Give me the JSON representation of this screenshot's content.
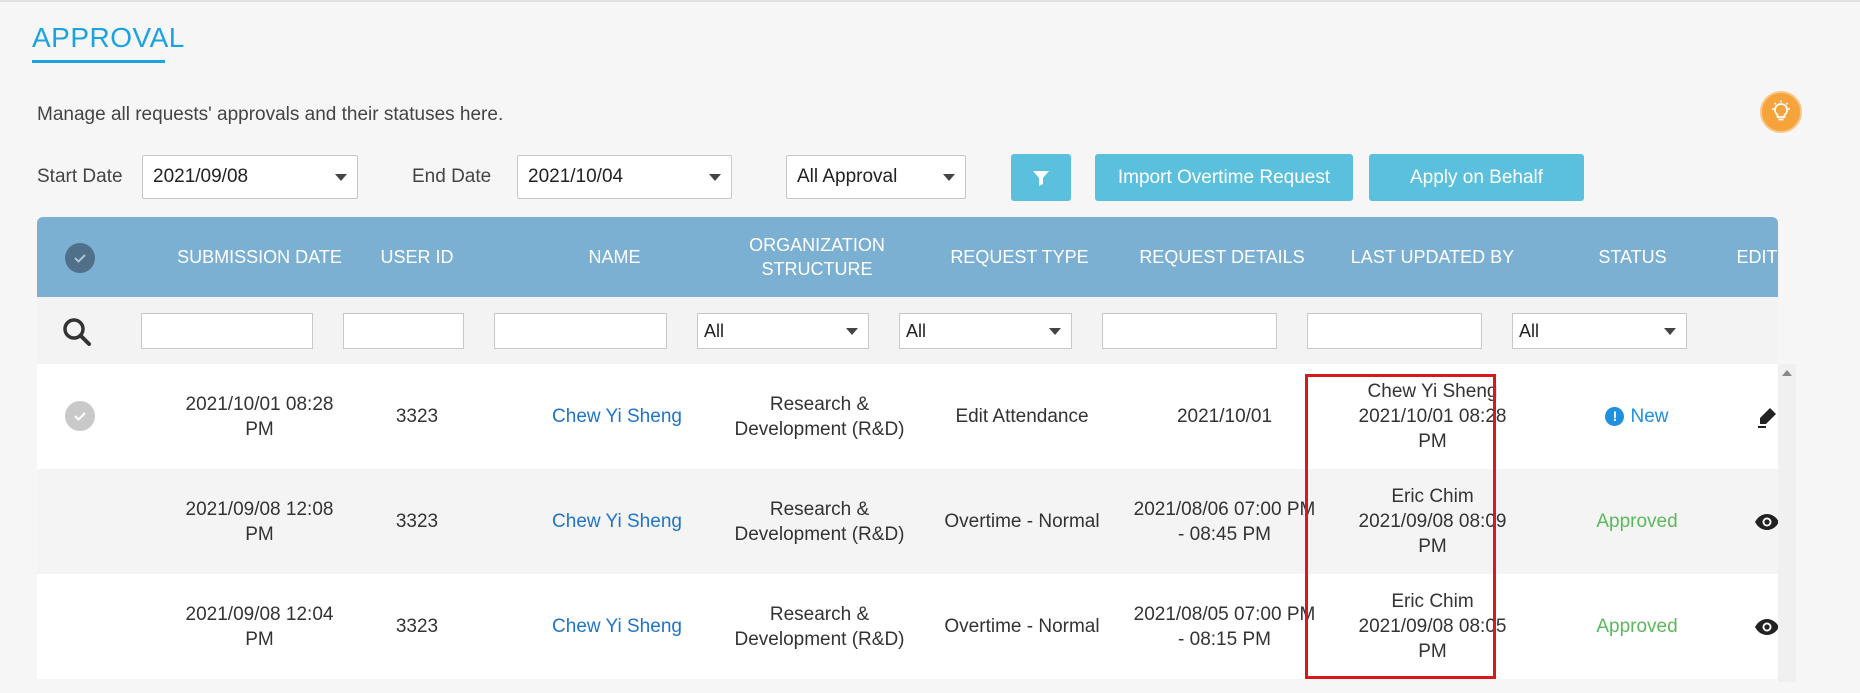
{
  "page": {
    "title": "APPROVAL",
    "description": "Manage all requests' approvals and their statuses here."
  },
  "filters": {
    "start_label": "Start Date",
    "start_value": "2021/09/08",
    "end_label": "End Date",
    "end_value": "2021/10/04",
    "approval_value": "All Approval",
    "import_overtime_label": "Import Overtime Request",
    "apply_on_behalf_label": "Apply on Behalf"
  },
  "table": {
    "headers": {
      "submission_date": "SUBMISSION DATE",
      "user_id": "USER ID",
      "name": "NAME",
      "organization_structure": "ORGANIZATION STRUCTURE",
      "request_type": "REQUEST TYPE",
      "request_details": "REQUEST DETAILS",
      "last_updated_by": "LAST UPDATED BY",
      "status": "STATUS",
      "edit": "EDIT"
    },
    "search": {
      "organization_select": "All",
      "request_type_select": "All",
      "status_select": "All"
    },
    "rows": [
      {
        "submission_date": "2021/10/01 08:28 PM",
        "user_id": "3323",
        "name": "Chew Yi Sheng",
        "organization": "Research & Development (R&D)",
        "request_type": "Edit Attendance",
        "request_details": "2021/10/01",
        "last_updated_by_name": "Chew Yi Sheng",
        "last_updated_by_time": "2021/10/01 08:28 PM",
        "status": "New",
        "action": "edit"
      },
      {
        "submission_date": "2021/09/08 12:08 PM",
        "user_id": "3323",
        "name": "Chew Yi Sheng",
        "organization": "Research & Development (R&D)",
        "request_type": "Overtime - Normal",
        "request_details": "2021/08/06 07:00 PM - 08:45 PM",
        "last_updated_by_name": "Eric Chim",
        "last_updated_by_time": "2021/09/08 08:09 PM",
        "status": "Approved",
        "action": "view"
      },
      {
        "submission_date": "2021/09/08 12:04 PM",
        "user_id": "3323",
        "name": "Chew Yi Sheng",
        "organization": "Research & Development (R&D)",
        "request_type": "Overtime - Normal",
        "request_details": "2021/08/05 07:00 PM - 08:15 PM",
        "last_updated_by_name": "Eric Chim",
        "last_updated_by_time": "2021/09/08 08:05 PM",
        "status": "Approved",
        "action": "view"
      }
    ]
  },
  "colors": {
    "accent": "#1aa3e0",
    "header_bg": "#7bb0d3",
    "button_bg": "#5bc0de",
    "link": "#1f74c9",
    "approved": "#5cb85c",
    "new": "#1f8fe0",
    "highlight": "#d7191c"
  },
  "icons": {
    "tip": "lightbulb-icon",
    "filter": "filter-icon",
    "search": "search-icon",
    "select_all": "check-circle-icon",
    "edit": "pencil-icon",
    "view": "eye-icon"
  }
}
